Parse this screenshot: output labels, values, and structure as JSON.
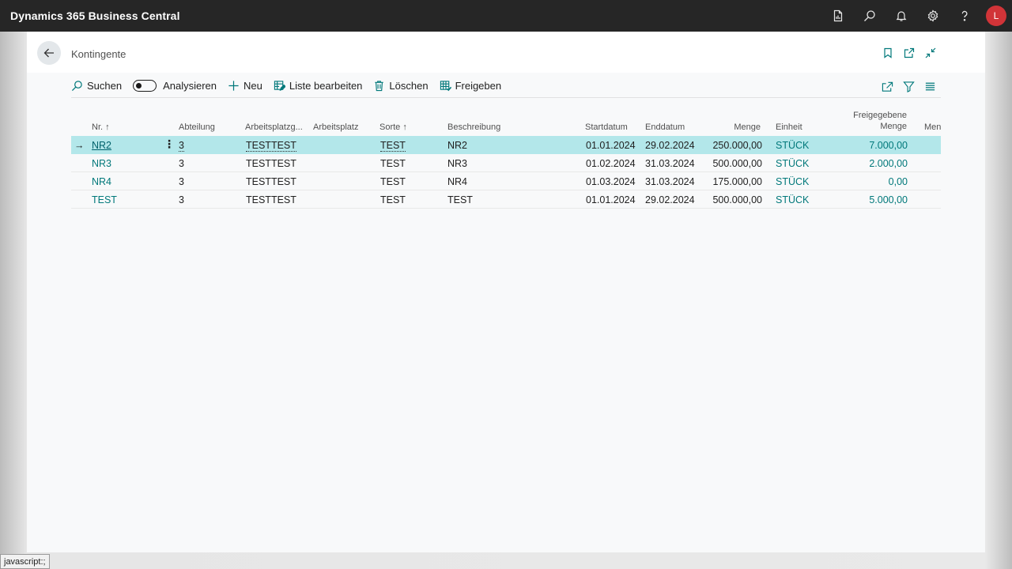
{
  "app": {
    "title": "Dynamics 365 Business Central",
    "user_initial": "L"
  },
  "topbar_icons": [
    "report-icon",
    "search-icon",
    "bell-icon",
    "gear-icon",
    "help-icon"
  ],
  "page": {
    "title": "Kontingente"
  },
  "actions": {
    "search": "Suchen",
    "analyze": "Analysieren",
    "new": "Neu",
    "edit_list": "Liste bearbeiten",
    "delete": "Löschen",
    "release": "Freigeben"
  },
  "columns": {
    "nr": "Nr.",
    "abteilung": "Abteilung",
    "arbeitsplatzgruppe": "Arbeitsplatzg...",
    "arbeitsplatz": "Arbeitsplatz",
    "sorte": "Sorte",
    "beschreibung": "Beschreibung",
    "startdatum": "Startdatum",
    "enddatum": "Enddatum",
    "menge": "Menge",
    "einheit": "Einheit",
    "freigegebene_1": "Freigegebene",
    "freigegebene_2": "Menge",
    "menge_cut": "Meng"
  },
  "sort_arrow": "↑",
  "rows": [
    {
      "nr": "NR2",
      "abteilung": "3",
      "arbeitsplatzgruppe": "TESTTEST",
      "arbeitsplatz": "",
      "sorte": "TEST",
      "beschreibung": "NR2",
      "startdatum": "01.01.2024",
      "enddatum": "29.02.2024",
      "menge": "250.000,00",
      "einheit": "STÜCK",
      "freigegebene_menge": "7.000,00",
      "selected": true
    },
    {
      "nr": "NR3",
      "abteilung": "3",
      "arbeitsplatzgruppe": "TESTTEST",
      "arbeitsplatz": "",
      "sorte": "TEST",
      "beschreibung": "NR3",
      "startdatum": "01.02.2024",
      "enddatum": "31.03.2024",
      "menge": "500.000,00",
      "einheit": "STÜCK",
      "freigegebene_menge": "2.000,00",
      "selected": false
    },
    {
      "nr": "NR4",
      "abteilung": "3",
      "arbeitsplatzgruppe": "TESTTEST",
      "arbeitsplatz": "",
      "sorte": "TEST",
      "beschreibung": "NR4",
      "startdatum": "01.03.2024",
      "enddatum": "31.03.2024",
      "menge": "175.000,00",
      "einheit": "STÜCK",
      "freigegebene_menge": "0,00",
      "selected": false
    },
    {
      "nr": "TEST",
      "abteilung": "3",
      "arbeitsplatzgruppe": "TESTTEST",
      "arbeitsplatz": "",
      "sorte": "TEST",
      "beschreibung": "TEST",
      "startdatum": "01.01.2024",
      "enddatum": "29.02.2024",
      "menge": "500.000,00",
      "einheit": "STÜCK",
      "freigegebene_menge": "5.000,00",
      "selected": false
    }
  ],
  "statusbar": {
    "text": "javascript:;"
  },
  "colors": {
    "topbar": "#262626",
    "accent": "#00787a",
    "selected_row": "#b3e7ea",
    "avatar": "#d13438"
  }
}
